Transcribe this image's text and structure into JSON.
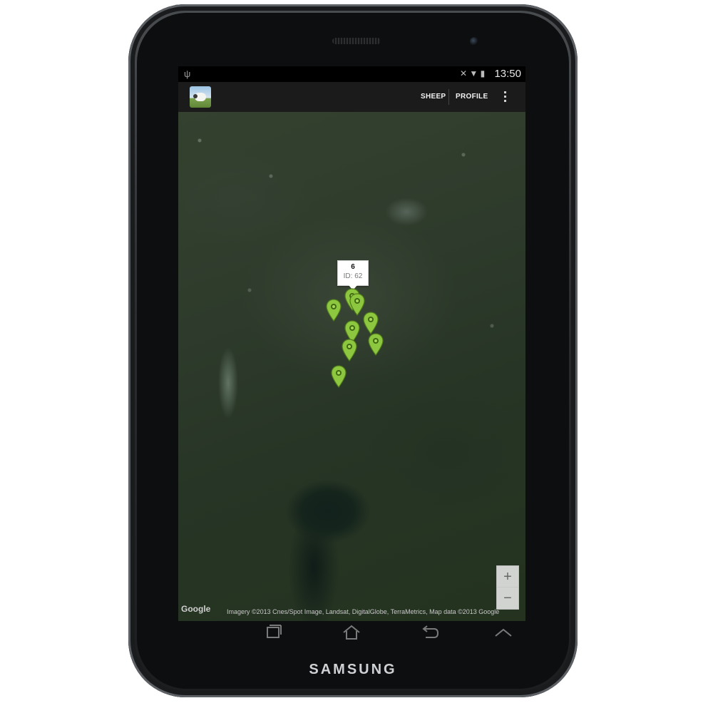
{
  "device": {
    "brand": "SAMSUNG"
  },
  "statusbar": {
    "usb_icon": "usb-icon",
    "icons": [
      "mute-icon",
      "wifi-icon",
      "battery-icon"
    ],
    "time": "13:50"
  },
  "actionbar": {
    "app_icon": "sheep-app-icon",
    "sheep_label": "SHEEP",
    "profile_label": "PROFILE",
    "overflow_icon": "overflow-menu-icon"
  },
  "map": {
    "type": "satellite",
    "callout": {
      "title": "6",
      "subtitle": "ID: 62"
    },
    "markers": [
      {
        "name": "sheep-marker"
      },
      {
        "name": "sheep-marker"
      },
      {
        "name": "sheep-marker"
      },
      {
        "name": "sheep-marker"
      },
      {
        "name": "sheep-marker"
      },
      {
        "name": "sheep-marker"
      },
      {
        "name": "sheep-marker"
      },
      {
        "name": "sheep-marker"
      }
    ],
    "marker_color": "#8dc63f",
    "zoom_in": "+",
    "zoom_out": "−",
    "logo": "Google",
    "attribution": "Imagery ©2013 Cnes/Spot Image, Landsat, DigitalGlobe, TerraMetrics, Map data ©2013 Google"
  },
  "navbar": {
    "buttons": [
      "recent-apps-icon",
      "home-icon",
      "back-icon",
      "up-arrow-icon"
    ]
  }
}
